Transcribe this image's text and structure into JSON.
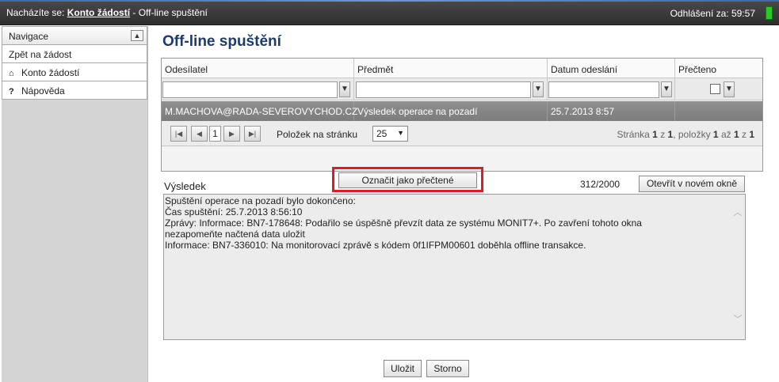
{
  "topbar": {
    "location_prefix": "Nacházíte se:",
    "location_link": "Konto žádostí",
    "location_current": " - Off-line spuštění",
    "logout_label": "Odhlášení za: 59:57"
  },
  "sidebar": {
    "title": "Navigace",
    "items": [
      {
        "label": "Zpět na žádost",
        "icon": ""
      },
      {
        "label": "Konto žádostí",
        "icon": "home-icon"
      },
      {
        "label": "Nápověda",
        "icon": "question-icon"
      }
    ]
  },
  "main": {
    "title": "Off-line spuštění"
  },
  "grid": {
    "columns": [
      "Odesílatel",
      "Předmět",
      "Datum odeslání",
      "Přečteno"
    ],
    "rows": [
      [
        "M.MACHOVA@RADA-SEVEROVYCHOD.CZ",
        "Výsledek operace na pozadí",
        "25.7.2013 8:57",
        ""
      ]
    ],
    "pager": {
      "current_page": "1",
      "page_size_label": "Položek na stránku",
      "page_size": "25",
      "info_prefix": "Stránka ",
      "info_page": "1",
      "info_mid1": " z ",
      "info_pages": "1",
      "info_mid2": ", položky ",
      "info_from": "1",
      "info_mid3": " až ",
      "info_to": "1",
      "info_mid4": " z ",
      "info_total": "1"
    }
  },
  "result": {
    "label": "Výsledek",
    "mark_read_button": "Označit jako přečtené",
    "counter": "312/2000",
    "open_new_window_button": "Otevřít v novém okně",
    "lines": [
      "Spuštění operace na pozadí bylo dokončeno:",
      "Čas spuštění: 25.7.2013 8:56:10",
      "Zprávy: Informace: BN7-178648: Podařilo se úspěšně převzít data ze systému MONIT7+. Po zavření tohoto okna",
      "nezapomeňte načtená data uložit",
      "Informace: BN7-336010: Na monitorovací zprávě s kódem 0f1IFPM00601 doběhla offline transakce."
    ]
  },
  "footer": {
    "save_button": "Uložit",
    "cancel_button": "Storno"
  },
  "colors": {
    "title_blue": "#1e3a6e",
    "highlight_red": "#e01b24",
    "status_green": "#2bc82b",
    "selected_row": "#878787"
  }
}
